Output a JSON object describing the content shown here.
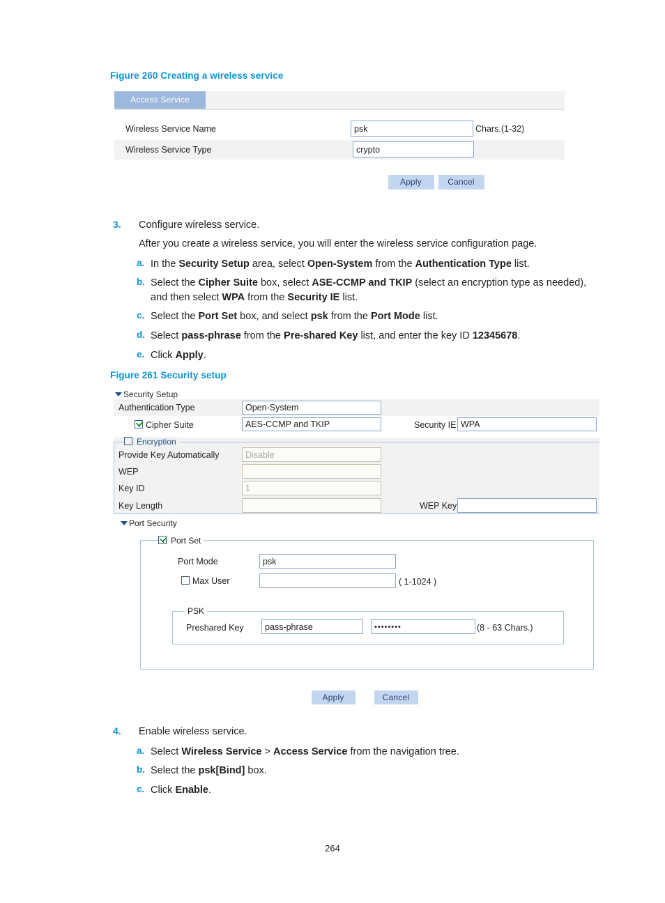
{
  "page": {
    "number": "264"
  },
  "figure260": {
    "caption": "Figure 260 Creating a wireless service",
    "tab_label": "Access Service",
    "rows": [
      {
        "label": "Wireless Service Name",
        "value": "psk",
        "hint": "Chars.(1-32)",
        "type": "text"
      },
      {
        "label": "Wireless Service Type",
        "value": "crypto",
        "hint": "",
        "type": "select"
      }
    ],
    "apply_label": "Apply",
    "cancel_label": "Cancel"
  },
  "step3": {
    "number": "3.",
    "title": "Configure wireless service.",
    "intro": "After you create a wireless service, you will enter the wireless service configuration page.",
    "items": [
      {
        "marker": "a.",
        "html": "In the <b>Security Setup</b> area, select <b>Open-System</b> from the <b>Authentication Type</b> list."
      },
      {
        "marker": "b.",
        "html": "Select the <b>Cipher Suite</b> box, select <b>ASE-CCMP and TKIP</b> (select an encryption type as needed),<br>and then select <b>WPA</b> from the <b>Security IE</b> list."
      },
      {
        "marker": "c.",
        "html": "Select the <b>Port Set</b> box, and select <b>psk</b> from the <b>Port Mode</b> list."
      },
      {
        "marker": "d.",
        "html": "Select <b>pass-phrase</b> from the <b>Pre-shared Key</b> list, and enter the key ID <b>12345678</b>."
      },
      {
        "marker": "e.",
        "html": "Click <b>Apply</b>."
      }
    ]
  },
  "figure261": {
    "caption": "Figure 261 Security setup",
    "security_setup": {
      "section_label": "Security Setup",
      "auth_type_label": "Authentication Type",
      "auth_type_value": "Open-System",
      "cipher_suite_label": "Cipher Suite",
      "cipher_suite_checked": true,
      "cipher_suite_value": "AES-CCMP and TKIP",
      "security_ie_label": "Security IE",
      "security_ie_value": "WPA"
    },
    "encryption": {
      "legend": "Encryption",
      "checked": false,
      "rows": [
        {
          "label": "Provide Key Automatically",
          "value": "Disable"
        },
        {
          "label": "WEP",
          "value": ""
        },
        {
          "label": "Key ID",
          "value": "1"
        },
        {
          "label": "Key Length",
          "value": ""
        }
      ],
      "wep_key_label": "WEP Key",
      "wep_key_value": ""
    },
    "port_security": {
      "section_label": "Port Security",
      "port_set_legend": "Port Set",
      "port_set_checked": true,
      "port_mode_label": "Port Mode",
      "port_mode_value": "psk",
      "max_user_label": "Max User",
      "max_user_checked": false,
      "max_user_value": "",
      "max_user_hint": "( 1-1024 )",
      "psk_legend": "PSK",
      "preshared_key_label": "Preshared Key",
      "preshared_key_type": "pass-phrase",
      "preshared_key_value": "••••••••",
      "preshared_key_hint": "(8 - 63 Chars.)"
    },
    "apply_label": "Apply",
    "cancel_label": "Cancel"
  },
  "step4": {
    "number": "4.",
    "title": "Enable wireless service.",
    "items": [
      {
        "marker": "a.",
        "html": "Select <b>Wireless Service</b> &gt; <b>Access Service</b> from the navigation tree."
      },
      {
        "marker": "b.",
        "html": "Select the <b>psk[Bind]</b> box."
      },
      {
        "marker": "c.",
        "html": "Click <b>Enable</b>."
      }
    ]
  },
  "colors": {
    "accent": "#0b93d5",
    "tab": "#9cb8dd",
    "button": "#c3d6f0",
    "field_border": "#8ba4c4"
  }
}
